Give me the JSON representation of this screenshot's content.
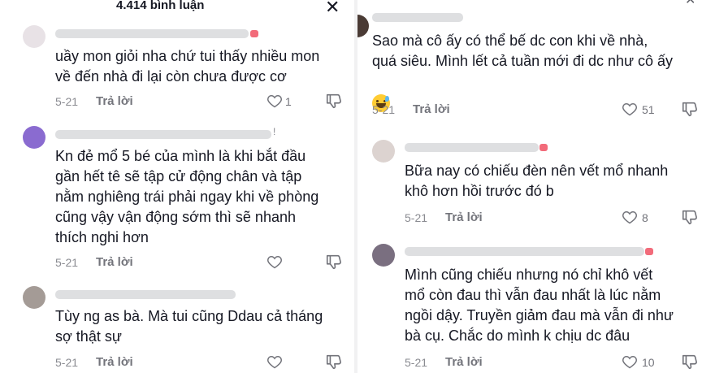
{
  "left": {
    "header": {
      "count": "4.414 bình luận",
      "close_icon": "close-icon"
    },
    "comments": [
      {
        "text": "uầy mon giỏi nha chứ tui thấy nhiều mon\nvề đến nhà đi lại còn chưa được cơ",
        "date": "5-21",
        "reply": "Trả lời",
        "likes": "1",
        "avatar_color": "#e8e2e6"
      },
      {
        "text": "Kn đẻ mổ 5 bé của mình là khi bắt đầu\ngần hết tê sẽ tập cử động chân và tập\nnằm nghiêng trái phải ngay khi về phòng\ncũng vậy vận động sớm thì sẽ nhanh\nthích nghi hơn",
        "date": "5-21",
        "reply": "Trả lời",
        "likes": "",
        "meta_suffix": "!",
        "avatar_color": "#8a6bd0"
      },
      {
        "text": "Tùy ng as bà. Mà tui cũng Ddau cả tháng\nsợ thật sự",
        "date": "5-21",
        "reply": "Trả lời",
        "likes": "",
        "avatar_color": "#a49b96"
      }
    ]
  },
  "right": {
    "comments": [
      {
        "text": "Sao mà cô ấy có thể bế dc con khi về nhà,\nquá siêu. Mình lết cả tuần mới đi dc như cô ấy",
        "date": "5-21",
        "reply": "Trả lời",
        "likes": "51",
        "emoji": "grinning-sweat-emoji",
        "avatar_color": "#4a3b35"
      },
      {
        "text": "Bữa nay có chiếu đèn nên vết mổ nhanh\nkhô hơn hồi trước đó b",
        "date": "5-21",
        "reply": "Trả lời",
        "likes": "8",
        "avatar_color": "#dcd3d0"
      },
      {
        "text": "Mình cũng chiếu nhưng nó chỉ khô vết\nmổ còn đau thì vẫn đau nhất là lúc nằm\nngồi dậy. Truyền giảm đau mà vẫn đi như\nbà cụ. Chắc do mình k chịu dc đâu",
        "date": "5-21",
        "reply": "Trả lời",
        "likes": "10",
        "avatar_color": "#7a6f80"
      }
    ]
  },
  "colors": {
    "text": "#161823",
    "muted": "#8a8b91",
    "reply": "#73747b"
  }
}
